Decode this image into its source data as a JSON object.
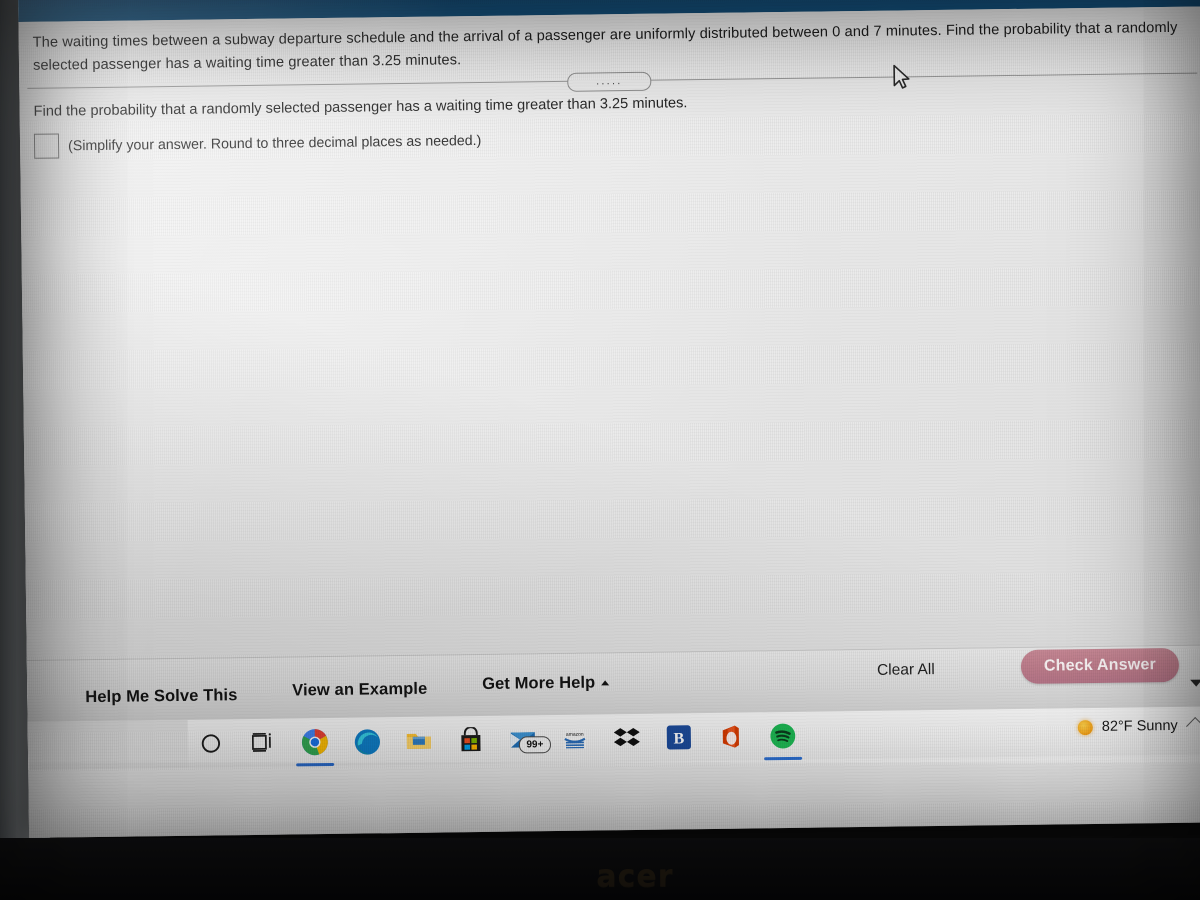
{
  "app": {
    "header_color": "#15527e"
  },
  "problem": {
    "statement": "The waiting times between a subway departure schedule and the arrival of a passenger are uniformly distributed between 0 and 7 minutes. Find the probability that a randomly selected passenger has a waiting time greater than 3.25 minutes.",
    "divider_dots": ".....",
    "prompt": "Find the probability that a randomly selected passenger has a waiting time greater than 3.25 minutes.",
    "answer_value": "",
    "answer_placeholder": "",
    "answer_note": "(Simplify your answer. Round to three decimal places as needed.)"
  },
  "action_bar": {
    "help_me_solve_this": "Help Me Solve This",
    "view_an_example": "View an Example",
    "get_more_help": "Get More Help",
    "get_more_help_caret": "caret-up-icon",
    "clear_all": "Clear All",
    "check_answer": "Check Answer",
    "check_answer_color": "#c07e8d",
    "scroll_down_caret": "caret-down-icon"
  },
  "taskbar": {
    "items": [
      {
        "name": "search-icon",
        "glyph": "O",
        "active": false
      },
      {
        "name": "task-view-icon",
        "glyph": "",
        "active": false
      },
      {
        "name": "google-chrome-icon",
        "glyph": "",
        "active": true
      },
      {
        "name": "microsoft-edge-icon",
        "glyph": "",
        "active": false
      },
      {
        "name": "file-explorer-icon",
        "glyph": "",
        "active": false
      },
      {
        "name": "microsoft-store-icon",
        "glyph": "",
        "active": false
      },
      {
        "name": "mail-icon",
        "glyph": "",
        "badge": "99+",
        "active": false
      },
      {
        "name": "amazon-icon",
        "glyph": "",
        "active": false
      },
      {
        "name": "dropbox-icon",
        "glyph": "",
        "active": false
      },
      {
        "name": "blackboard-icon",
        "glyph": "B",
        "active": false
      },
      {
        "name": "microsoft-office-icon",
        "glyph": "",
        "active": false
      },
      {
        "name": "spotify-icon",
        "glyph": "",
        "active": true
      }
    ],
    "weather": {
      "icon": "sun-icon",
      "text": "82°F  Sunny",
      "chevron": "chevron-icon"
    }
  },
  "device": {
    "brand_logo": "acer"
  },
  "cursor": {
    "name": "mouse-pointer-icon"
  }
}
